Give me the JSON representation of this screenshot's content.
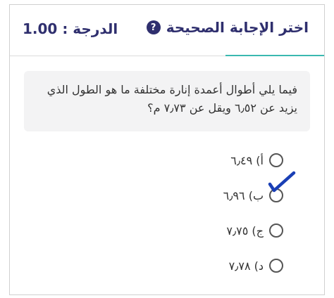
{
  "header": {
    "title": "اختر الإجابة الصحيحة",
    "help_icon": "question-circle-icon",
    "grade_label": "الدرجة : 1.00"
  },
  "question": {
    "text": "فيما يلي أطوال أعمدة إنارة مختلفة ما هو الطول الذي يزيد عن ٦٫٥٢ ويقل عن ٧٫٧٣ م؟"
  },
  "options": [
    {
      "label": "أ) ٦٫٤٩"
    },
    {
      "label": "ب) ٦٫٩٦",
      "hand_checked": true
    },
    {
      "label": "ج) ٧٫٧٥"
    },
    {
      "label": "د) ٧٫٧٨"
    }
  ],
  "colors": {
    "header_text": "#2f2f6e",
    "accent": "#3bb9b0",
    "check_mark": "#1a3fb5"
  }
}
